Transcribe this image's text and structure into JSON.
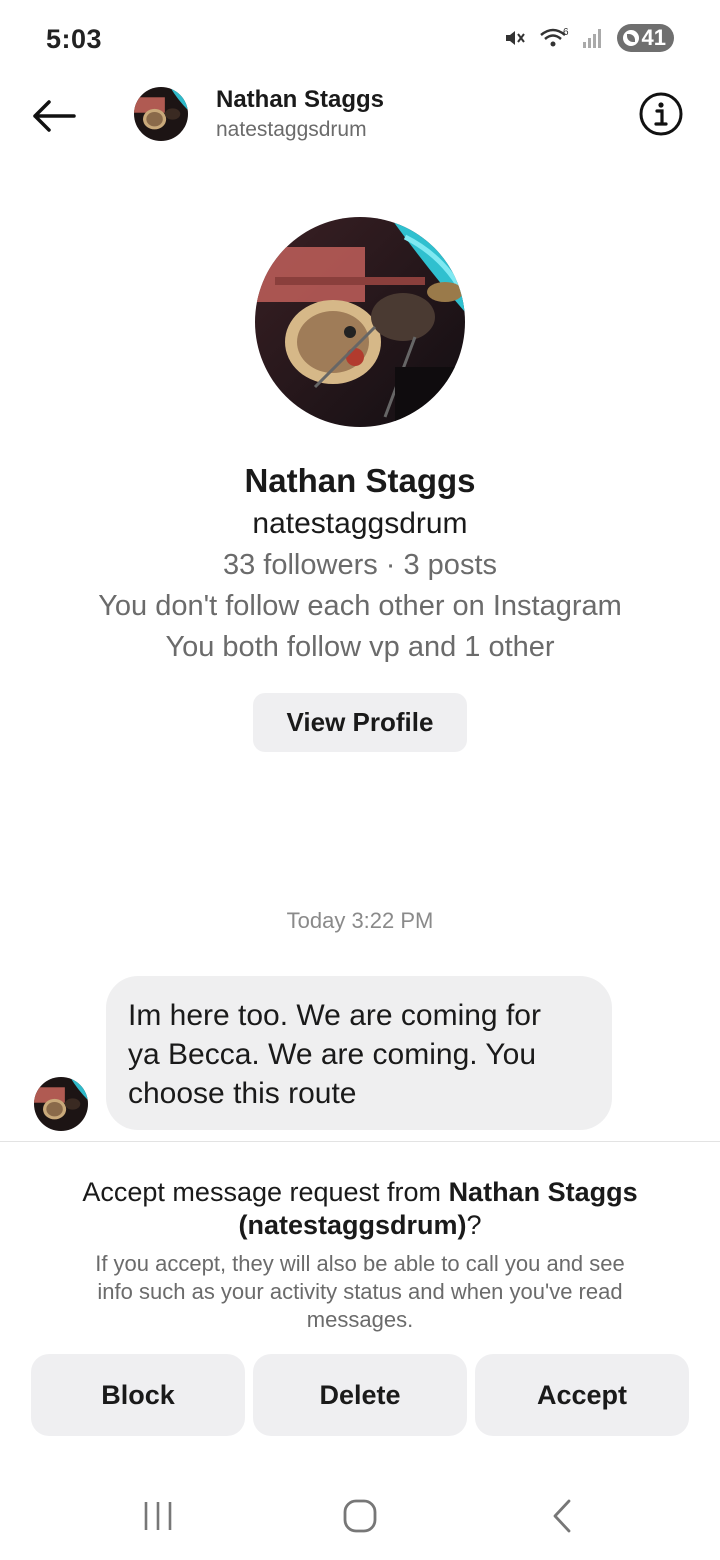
{
  "status_bar": {
    "time": "5:03",
    "battery": "41",
    "icons": [
      "mute-icon",
      "wifi-icon",
      "signal-icon",
      "battery-icon"
    ]
  },
  "header": {
    "name": "Nathan Staggs",
    "username": "natestaggsdrum",
    "icons": [
      "back-arrow-icon",
      "info-icon"
    ]
  },
  "profile": {
    "name": "Nathan Staggs",
    "username": "natestaggsdrum",
    "stats": "33 followers · 3 posts",
    "follow_status": "You don't follow each other on Instagram",
    "mutuals": "You both follow vp and 1 other",
    "view_profile_label": "View Profile"
  },
  "conversation": {
    "timestamp": "Today 3:22 PM",
    "messages": [
      {
        "lines": [
          "Im here too. We are coming for",
          "ya Becca. We are coming. You",
          "choose this route"
        ]
      }
    ]
  },
  "request": {
    "title_prefix": "Accept message request from ",
    "title_name": "Nathan Staggs",
    "title_username": "(natestaggsdrum)",
    "title_suffix": "?",
    "description_lines": [
      "If you accept, they will also be able to call you and see",
      "info such as your activity status and when you've read",
      "messages."
    ],
    "actions": {
      "block": "Block",
      "delete": "Delete",
      "accept": "Accept"
    }
  },
  "nav_bar": {
    "icons": [
      "recents-icon",
      "home-icon",
      "back-icon"
    ]
  },
  "colors": {
    "bubble": "#efeff0",
    "button": "#efeff1",
    "secondary_text": "#6b6b6b"
  }
}
